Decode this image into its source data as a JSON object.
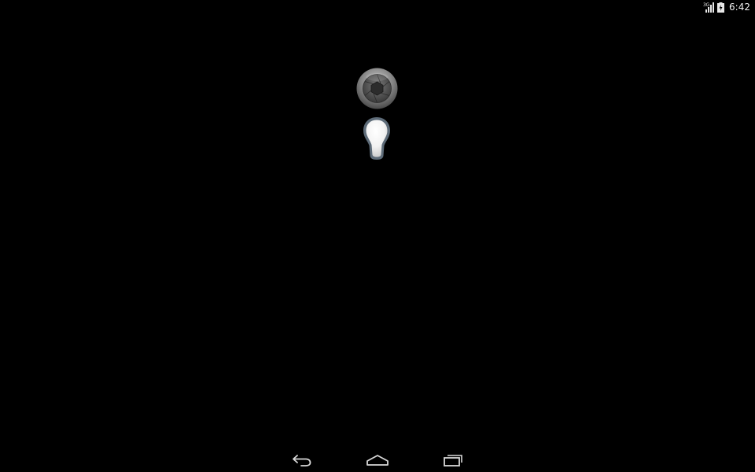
{
  "status_bar": {
    "network_type": "3G",
    "time": "6:42",
    "icons": [
      "signal-icon",
      "battery-charging-icon"
    ]
  },
  "main": {
    "camera_button_icon": "camera-shutter-icon",
    "light_toggle_icon": "light-bulb-icon"
  },
  "nav_bar": {
    "buttons": [
      "back-icon",
      "home-icon",
      "recent-apps-icon"
    ]
  }
}
